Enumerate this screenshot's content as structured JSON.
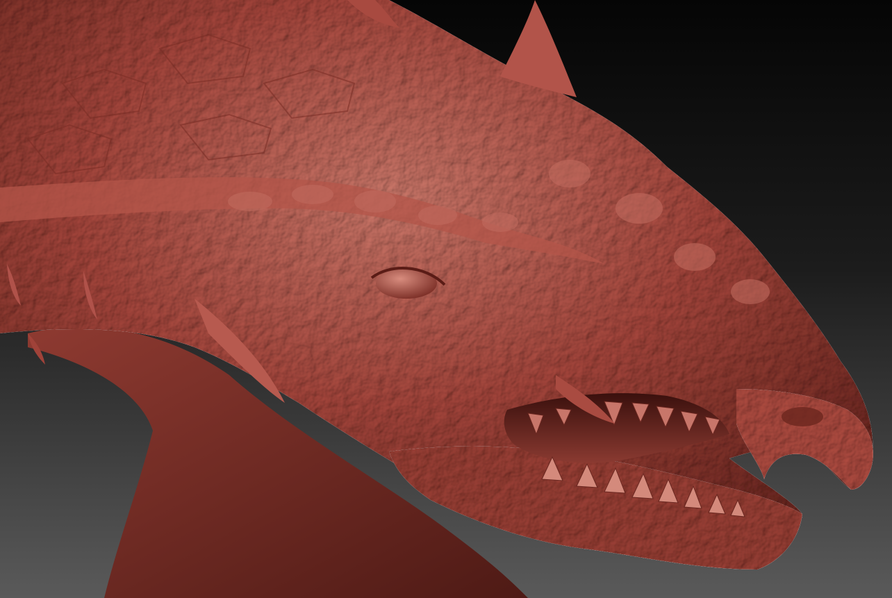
{
  "scene": {
    "subject": "dragon-head-sculpt",
    "material_color": "#a8473d",
    "material_highlight": "#cf7a6c",
    "material_shadow": "#5c1f19",
    "background_top": "#050505",
    "background_bottom": "#5a5a5a"
  }
}
